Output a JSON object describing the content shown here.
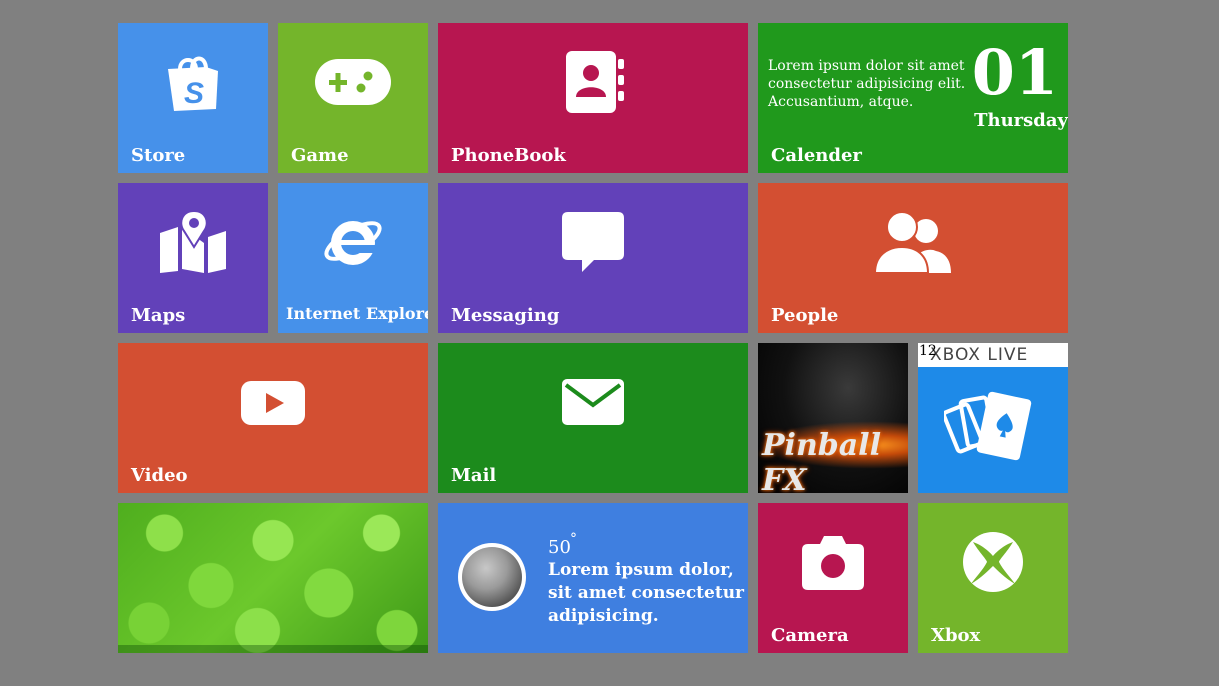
{
  "tiles": {
    "store": {
      "label": "Store"
    },
    "game": {
      "label": "Game"
    },
    "phonebook": {
      "label": "PhoneBook"
    },
    "calendar": {
      "label": "Calender",
      "text": "Lorem ipsum dolor sit amet consectetur adipisicing elit. Accusantium, atque.",
      "day": "01",
      "weekday": "Thursday"
    },
    "maps": {
      "label": "Maps"
    },
    "ie": {
      "label": "Internet Explorer"
    },
    "messaging": {
      "label": "Messaging"
    },
    "people": {
      "label": "People"
    },
    "video": {
      "label": "Video"
    },
    "mail": {
      "label": "Mail"
    },
    "pinball": {
      "title": "Pinball FX"
    },
    "xbox_live": {
      "logo": "XBOX LIVE",
      "count": "12"
    },
    "weather": {
      "temperature": "50",
      "degree": "°",
      "text": "Lorem ipsum dolor, sit amet consectetur adipisicing."
    },
    "camera": {
      "label": "Camera"
    },
    "xbox": {
      "label": "Xbox"
    }
  },
  "colors": {
    "background": "#808080",
    "blue": "#4691ea",
    "green": "#74b52b",
    "crimson": "#b71650",
    "dark_green": "#20991c",
    "purple": "#6241b9",
    "orange": "#d34f32"
  },
  "icons": [
    "shopping-bag-icon",
    "gamepad-icon",
    "contact-book-icon",
    "map-icon",
    "internet-explorer-icon",
    "chat-bubble-icon",
    "people-icon",
    "youtube-play-icon",
    "envelope-icon",
    "cards-icon",
    "moon-icon",
    "camera-icon",
    "xbox-icon"
  ]
}
